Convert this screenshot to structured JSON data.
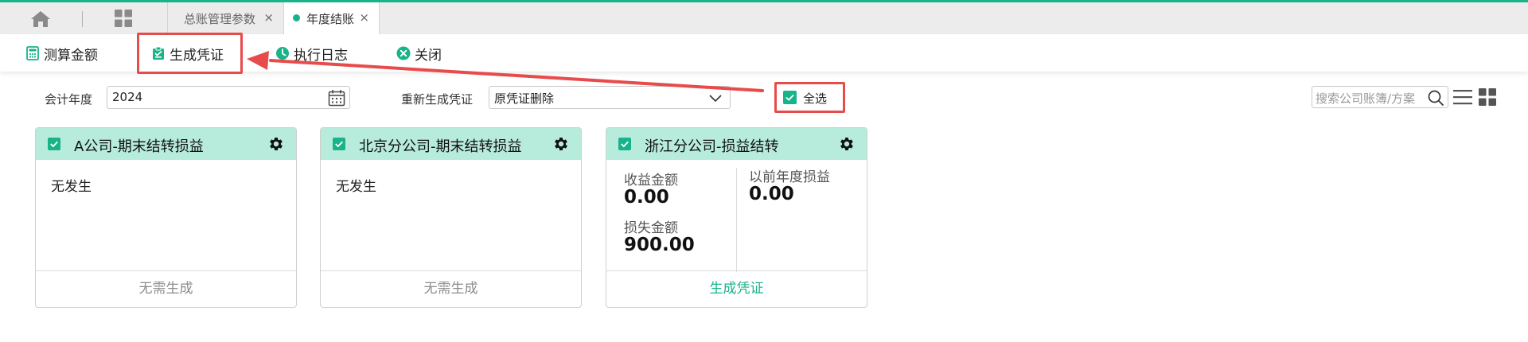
{
  "tabs": {
    "tab1_label": "总账管理参数",
    "tab2_label": "年度结账",
    "close_glyph": "×"
  },
  "toolbar": {
    "calc_label": "测算金额",
    "generate_label": "生成凭证",
    "log_label": "执行日志",
    "close_label": "关闭"
  },
  "filters": {
    "year_label": "会计年度",
    "year_value": "2024",
    "regen_label": "重新生成凭证",
    "regen_value": "原凭证删除",
    "select_all_label": "全选",
    "select_all_checked": true,
    "search_placeholder": "搜索公司账簿/方案"
  },
  "cards": [
    {
      "title": "A公司-期末结转损益",
      "checked": true,
      "body": "无发生",
      "footer": "无需生成"
    },
    {
      "title": "北京分公司-期末结转损益",
      "checked": true,
      "body": "无发生",
      "footer": "无需生成"
    },
    {
      "title": "浙江分公司-损益结转",
      "checked": true,
      "income_label": "收益金额",
      "income_value": "0.00",
      "loss_label": "损失金额",
      "loss_value": "900.00",
      "prior_label": "以前年度损益",
      "prior_value": "0.00",
      "footer": "生成凭证"
    }
  ],
  "colors": {
    "accent": "#19b38a",
    "card_header": "#b7ebdb",
    "annotation": "#e84b4b"
  },
  "icons": [
    "home-icon",
    "apps-grid-icon",
    "calculator-icon",
    "clipboard-check-icon",
    "clock-icon",
    "close-circle-icon",
    "calendar-icon",
    "chevron-down-icon",
    "checkbox-checked-icon",
    "search-icon",
    "list-view-icon",
    "grid-view-icon",
    "gear-icon"
  ]
}
